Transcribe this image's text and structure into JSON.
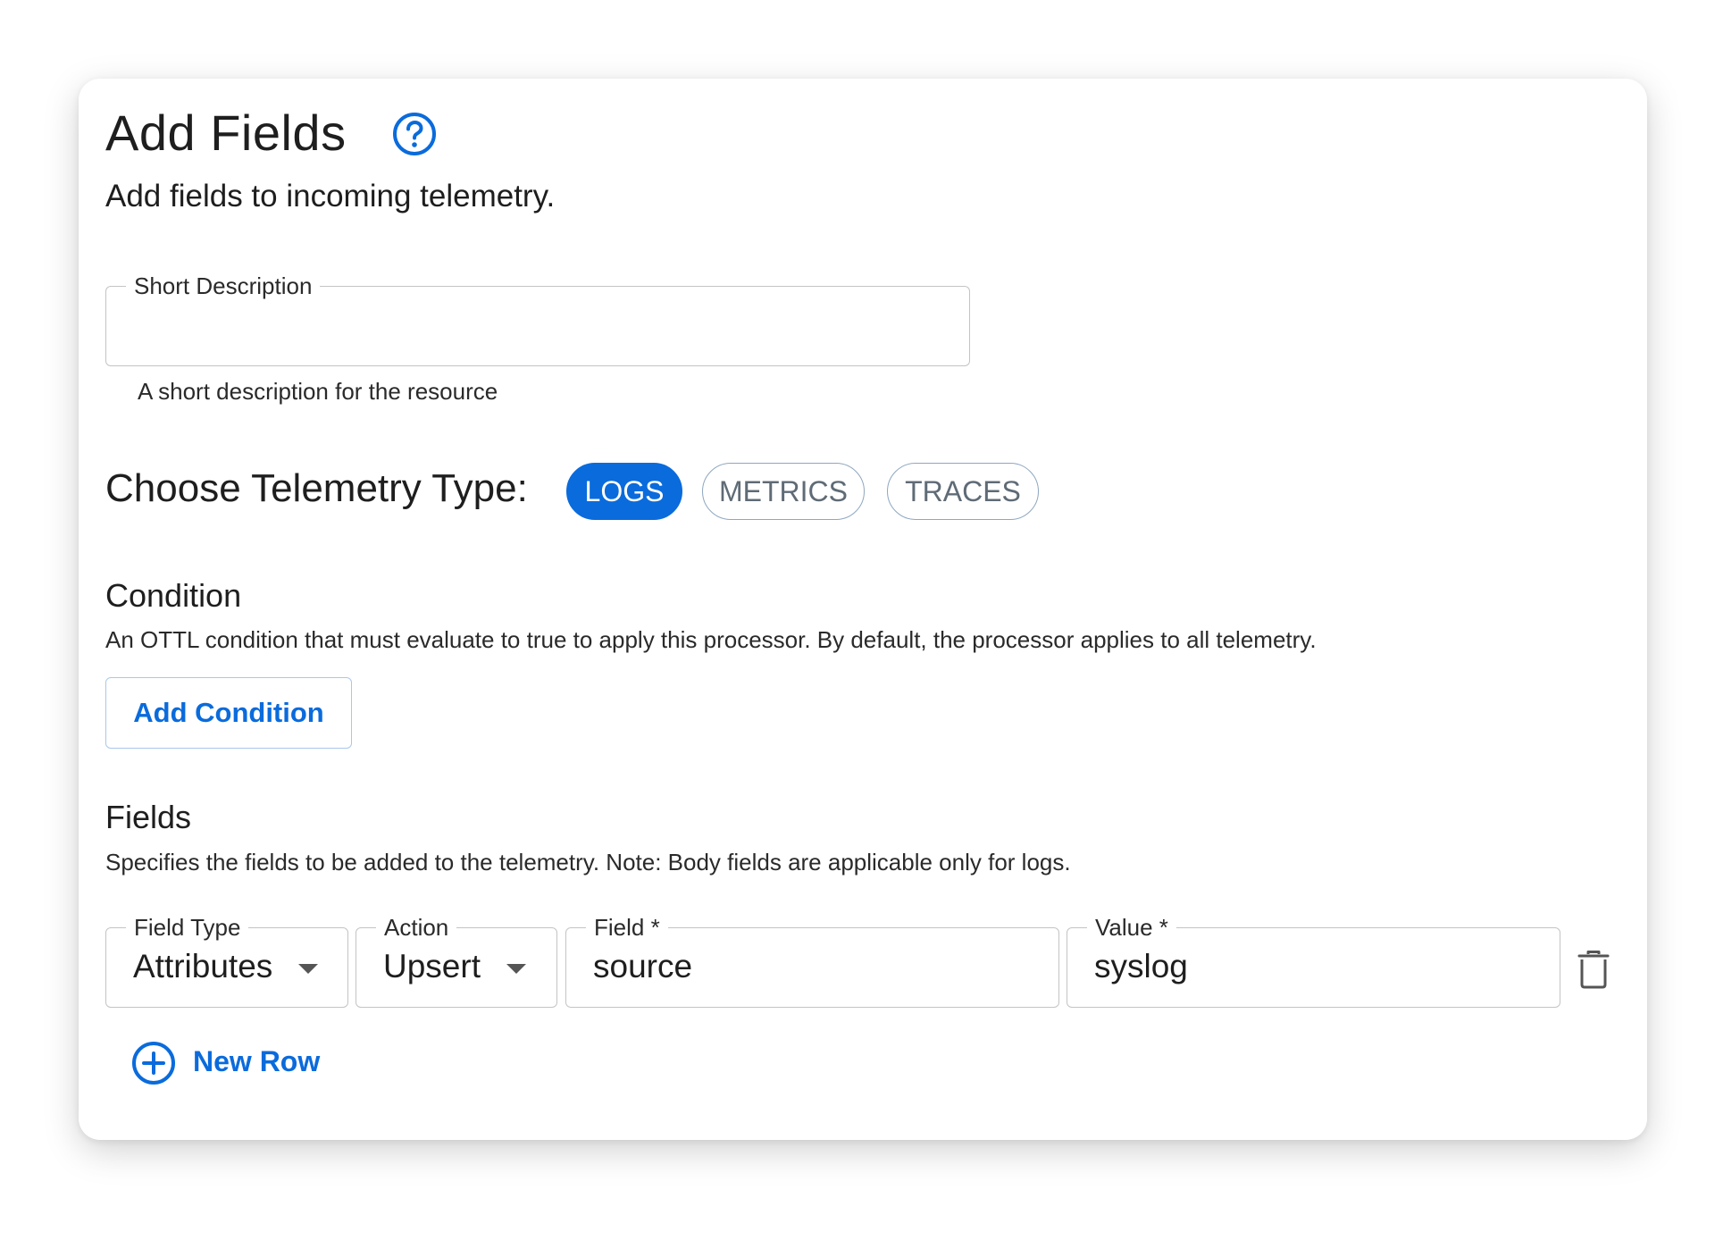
{
  "header": {
    "title": "Add Fields",
    "subtitle": "Add fields to incoming telemetry."
  },
  "short_description": {
    "label": "Short Description",
    "value": "",
    "helper": "A short description for the resource"
  },
  "telemetry": {
    "label": "Choose Telemetry Type:",
    "options": [
      "LOGS",
      "METRICS",
      "TRACES"
    ],
    "selected": "LOGS"
  },
  "condition": {
    "title": "Condition",
    "description": "An OTTL condition that must evaluate to true to apply this processor. By default, the processor applies to all telemetry.",
    "button_label": "Add Condition"
  },
  "fields": {
    "title": "Fields",
    "description": "Specifies the fields to be added to the telemetry. Note: Body fields are applicable only for logs.",
    "row": {
      "field_type_label": "Field Type",
      "field_type_value": "Attributes",
      "action_label": "Action",
      "action_value": "Upsert",
      "field_label": "Field *",
      "field_value": "source",
      "value_label": "Value *",
      "value_value": "syslog"
    },
    "new_row_label": "New Row"
  },
  "colors": {
    "accent": "#0a6bdc"
  },
  "icons": {
    "help": "help-circle-icon",
    "delete": "trash-icon",
    "add": "plus-circle-icon",
    "dropdown": "caret-down-icon"
  }
}
